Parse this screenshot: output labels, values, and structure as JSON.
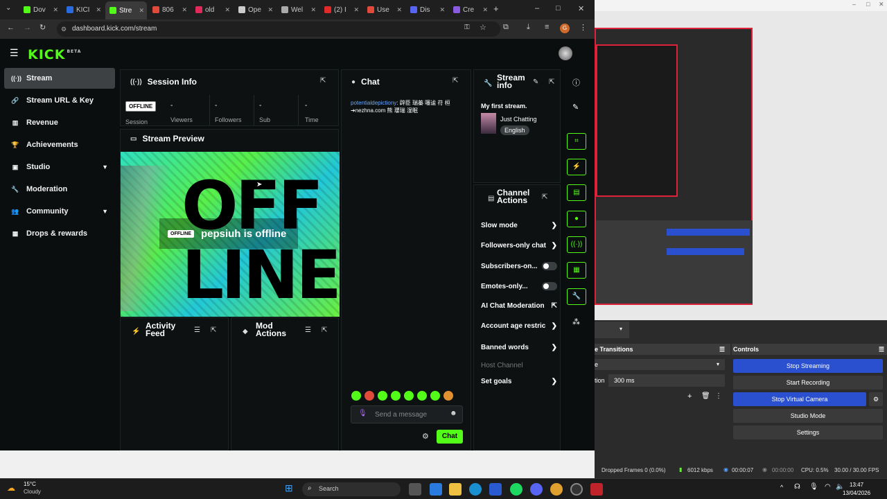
{
  "browser": {
    "tabs": [
      {
        "label": "Dov",
        "color": "#53fc18"
      },
      {
        "label": "KICI",
        "color": "#2a6be0"
      },
      {
        "label": "Stre",
        "color": "#53fc18",
        "active": true
      },
      {
        "label": "806",
        "color": "#e04a3a"
      },
      {
        "label": "old",
        "color": "#e02a5a"
      },
      {
        "label": "Ope",
        "color": "#cccccc"
      },
      {
        "label": "Wel",
        "color": "#aaaaaa"
      },
      {
        "label": "(2) I",
        "color": "#e02a2a"
      },
      {
        "label": "Use",
        "color": "#e04a3a"
      },
      {
        "label": "Dis",
        "color": "#5865f2"
      },
      {
        "label": "Cre",
        "color": "#8a5ae0"
      }
    ],
    "new_tab": "+",
    "url": "dashboard.kick.com/stream",
    "profile_letter": "G"
  },
  "kick": {
    "logo": "KICK",
    "logo_badge": "BETA",
    "sidebar": [
      {
        "label": "Stream",
        "icon": "broadcast-icon",
        "glyph": "((·))",
        "selected": true
      },
      {
        "label": "Stream URL & Key",
        "icon": "link-icon",
        "glyph": "🔗"
      },
      {
        "label": "Revenue",
        "icon": "chart-icon",
        "glyph": "▥"
      },
      {
        "label": "Achievements",
        "icon": "trophy-icon",
        "glyph": "🏆"
      },
      {
        "label": "Studio",
        "icon": "studio-icon",
        "glyph": "▣",
        "chevron": true
      },
      {
        "label": "Moderation",
        "icon": "wrench-icon",
        "glyph": "🔧"
      },
      {
        "label": "Community",
        "icon": "people-icon",
        "glyph": "👥",
        "chevron": true
      },
      {
        "label": "Drops & rewards",
        "icon": "gift-icon",
        "glyph": "▦"
      }
    ],
    "session_info": {
      "title": "Session Info",
      "status": "OFFLINE",
      "status_label": "Session",
      "stats": [
        {
          "value": "-",
          "label": "Viewers"
        },
        {
          "value": "-",
          "label": "Followers"
        },
        {
          "value": "-",
          "label": "Sub"
        },
        {
          "value": "-",
          "label": "Time"
        }
      ]
    },
    "stream_preview": {
      "title": "Stream Preview",
      "badge": "OFFLINE",
      "message": "pepsiuh is offline",
      "bg_word_1": "OFF",
      "bg_word_2": "LINE"
    },
    "activity_feed": {
      "title": "Activity Feed"
    },
    "mod_actions": {
      "title": "Mod Actions"
    },
    "chat": {
      "title": "Chat",
      "message_user": "potentialdepictiony",
      "message_text": ": 辟臣 瑞蓁 噻谧 苻 桓 ➔nezhna.com 熊 瓔瑞 湿眠",
      "input_placeholder": "Send a message",
      "send_label": "Chat"
    },
    "stream_info": {
      "title": "Stream info",
      "stream_title": "My first stream.",
      "category": "Just Chatting",
      "language": "English"
    },
    "channel_actions": {
      "title": "Channel Actions",
      "items": [
        {
          "label": "Slow mode",
          "control": "chevron"
        },
        {
          "label": "Followers-only chat",
          "control": "chevron"
        },
        {
          "label": "Subscribers-on...",
          "control": "toggle"
        },
        {
          "label": "Emotes-only...",
          "control": "toggle"
        },
        {
          "label": "AI Chat Moderation",
          "control": "external"
        },
        {
          "label": "Account age restric",
          "control": "chevron"
        },
        {
          "label": "Banned words",
          "control": "chevron"
        },
        {
          "label": "Host Channel",
          "control": "none",
          "disabled": true
        },
        {
          "label": "Set goals",
          "control": "chevron"
        }
      ]
    }
  },
  "obs": {
    "transitions_title": "e Transitions",
    "controls_title": "Controls",
    "duration_label": "tion",
    "duration_value": "300 ms",
    "buttons": [
      {
        "label": "Stop Streaming",
        "active": true
      },
      {
        "label": "Start Recording",
        "active": false
      },
      {
        "label": "Stop Virtual Camera",
        "active": true
      },
      {
        "label": "Studio Mode",
        "active": false
      },
      {
        "label": "Settings",
        "active": false
      }
    ],
    "status": {
      "dropped": "Dropped Frames 0 (0.0%)",
      "bitrate": "6012 kbps",
      "live_time": "00:00:07",
      "rec_time": "00:00:00",
      "cpu": "CPU: 0.5%",
      "fps": "30.00 / 30.00 FPS"
    }
  },
  "taskbar": {
    "weather_temp": "15°C",
    "weather_desc": "Cloudy",
    "search_label": "Search",
    "time": "13:47",
    "date": "13/04/2026"
  }
}
